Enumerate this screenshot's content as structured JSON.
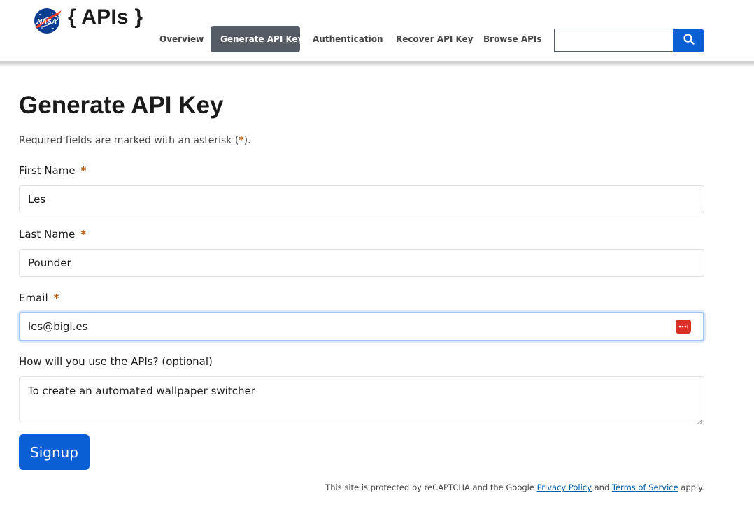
{
  "header": {
    "logo_text": "NASA",
    "site_title": "{ APIs }",
    "nav": [
      {
        "label": "Overview"
      },
      {
        "label": "Generate API Key"
      },
      {
        "label": "Authentication"
      },
      {
        "label": "Recover API Key"
      },
      {
        "label": "Browse APIs"
      }
    ],
    "search_value": "",
    "search_icon": "search-icon"
  },
  "main": {
    "title": "Generate API Key",
    "required_note_before": "Required fields are marked with an asterisk (",
    "required_note_asterisk": "*",
    "required_note_after": ").",
    "required_marker": "*",
    "first_name": {
      "label": "First Name",
      "value": "Les"
    },
    "last_name": {
      "label": "Last Name",
      "value": "Pounder"
    },
    "email": {
      "label": "Email",
      "value": "les@bigl.es"
    },
    "usage": {
      "label": "How will you use the APIs? (optional)",
      "value": "To create an automated wallpaper switcher"
    },
    "signup_label": "Signup"
  },
  "footer": {
    "recaptcha_before": "This site is protected by reCAPTCHA and the Google ",
    "privacy_link": "Privacy Policy",
    "and_text": " and ",
    "terms_link": "Terms of Service",
    "after_text": " apply."
  },
  "colors": {
    "accent": "#0b5fd4",
    "nav_active_bg": "#565c65",
    "required": "#c05600",
    "password_manager": "#d93025"
  }
}
